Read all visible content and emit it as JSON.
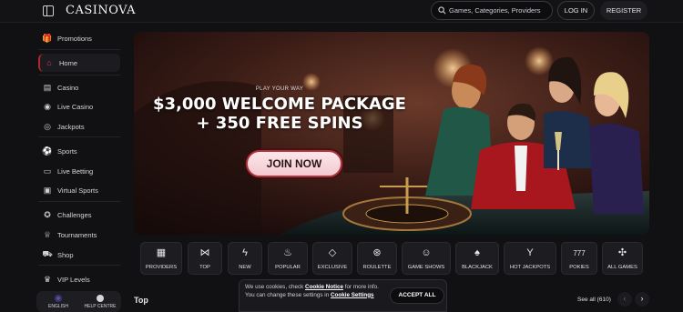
{
  "header": {
    "logo": "CASINOVA",
    "search_placeholder": "Games, Categories, Providers",
    "login_label": "LOG IN",
    "register_label": "REGISTER"
  },
  "sidebar": {
    "items": [
      {
        "label": "Promotions",
        "icon": "gift-icon"
      },
      {
        "label": "Home",
        "icon": "home-icon",
        "active": true
      },
      {
        "label": "Casino",
        "icon": "cards-icon"
      },
      {
        "label": "Live Casino",
        "icon": "live-icon"
      },
      {
        "label": "Jackpots",
        "icon": "coin-icon"
      },
      {
        "label": "Sports",
        "icon": "ball-icon"
      },
      {
        "label": "Live Betting",
        "icon": "tv-icon"
      },
      {
        "label": "Virtual Sports",
        "icon": "monitor-icon"
      },
      {
        "label": "Challenges",
        "icon": "medal-icon"
      },
      {
        "label": "Tournaments",
        "icon": "trophy-icon"
      },
      {
        "label": "Shop",
        "icon": "cart-icon"
      },
      {
        "label": "VIP Levels",
        "icon": "crown-icon"
      }
    ],
    "footer": {
      "language": "ENGLISH",
      "help": "HELP CENTRE"
    }
  },
  "hero": {
    "eyebrow": "PLAY YOUR WAY",
    "title_line1": "$3,000 WELCOME PACKAGE",
    "title_line2": "+ 350 FREE SPINS",
    "cta": "JOIN NOW"
  },
  "categories": [
    {
      "label": "PROVIDERS",
      "icon": "providers-icon"
    },
    {
      "label": "TOP",
      "icon": "bowtie-icon"
    },
    {
      "label": "NEW",
      "icon": "lightning-icon"
    },
    {
      "label": "POPULAR",
      "icon": "flame-icon"
    },
    {
      "label": "EXCLUSIVE",
      "icon": "diamond-icon"
    },
    {
      "label": "ROULETTE",
      "icon": "roulette-icon"
    },
    {
      "label": "GAME SHOWS",
      "icon": "mask-icon"
    },
    {
      "label": "BLACKJACK",
      "icon": "cards-icon"
    },
    {
      "label": "HOT JACKPOTS",
      "icon": "drink-icon"
    },
    {
      "label": "POKIES",
      "icon": "slot-777-icon"
    },
    {
      "label": "ALL GAMES",
      "icon": "grid-icon"
    }
  ],
  "section": {
    "title": "Top",
    "see_all": "See all (610)"
  },
  "cookie": {
    "text_pre": "We use cookies, check ",
    "notice_link": "Cookie Notice",
    "text_mid": " for more info. You can change these settings in ",
    "settings_link": "Cookie Settings",
    "accept": "ACCEPT ALL"
  },
  "colors": {
    "accent": "#b3262e",
    "background": "#111113"
  }
}
